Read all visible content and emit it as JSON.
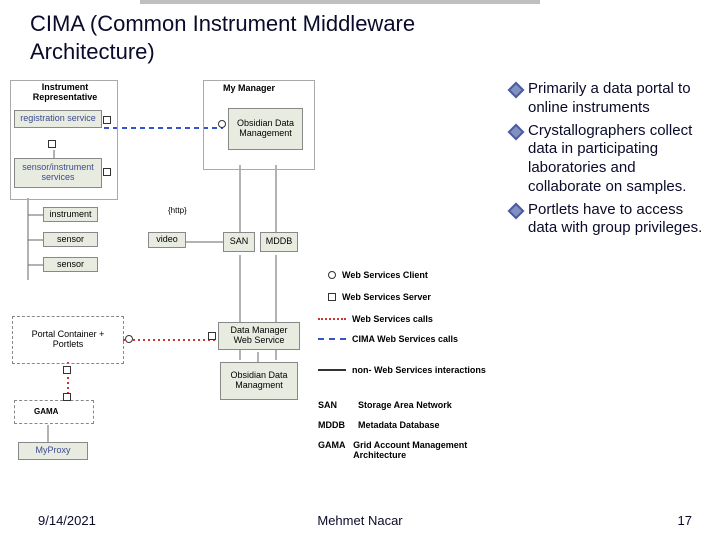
{
  "title": "CIMA (Common Instrument Middleware Architecture)",
  "bullets": [
    "Primarily a data portal to online instruments",
    "Crystallographers collect data in participating laboratories and collaborate on samples.",
    "Portlets have to access data with group privileges."
  ],
  "diagram": {
    "groups": {
      "instrument_rep": "Instrument\nRepresentative",
      "my_manager": "My Manager"
    },
    "boxes": {
      "registration": "registration service",
      "sensor_services": "sensor/instrument\nservices",
      "instrument": "instrument",
      "sensor1": "sensor",
      "sensor2": "sensor",
      "video": "video",
      "http": "{http}",
      "obsidian_top": "Obsidian\nData\nManagement",
      "san": "SAN",
      "mddb": "MDDB",
      "portal": "Portal Container\n+\nPortlets",
      "data_manager": "Data Manager\nWeb Service",
      "obsidian_bottom": "Obsidian\nData\nManagment",
      "gama": "GAMA",
      "myproxy": "MyProxy"
    },
    "legend": {
      "ws_client": "Web Services Client",
      "ws_server": "Web Services Server",
      "ws_calls": "Web Services calls",
      "cima_calls": "CIMA Web Services calls",
      "non_ws": "non- Web Services interactions",
      "san": "Storage Area Network",
      "mddb": "Metadata Database",
      "gama": "Grid Account Management Architecture",
      "san_key": "SAN",
      "mddb_key": "MDDB",
      "gama_key": "GAMA"
    }
  },
  "footer": {
    "date": "9/14/2021",
    "author": "Mehmet Nacar",
    "page": "17"
  }
}
